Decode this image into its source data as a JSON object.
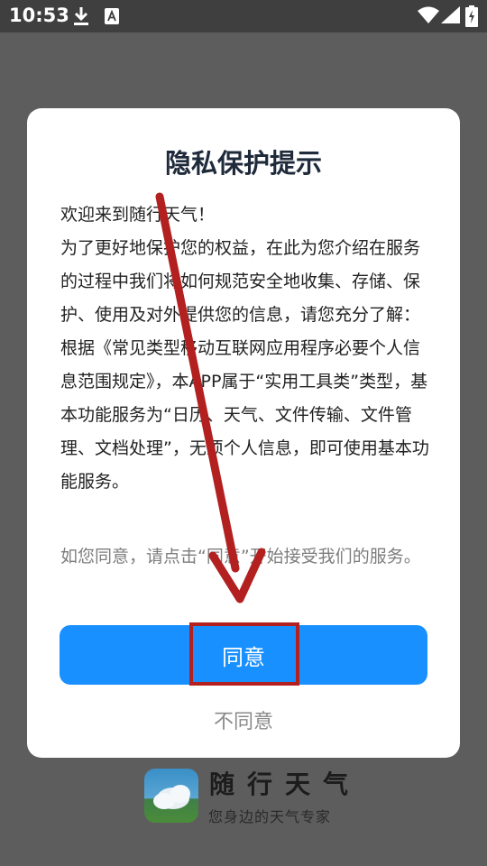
{
  "status_bar": {
    "time": "10:53",
    "icons": [
      "download-icon",
      "a-notification-icon",
      "wifi-icon",
      "signal-icon",
      "battery-charging-icon"
    ]
  },
  "splash": {
    "app_name": "随行天气",
    "tagline": "您身边的天气专家"
  },
  "dialog": {
    "title": "隐私保护提示",
    "paragraphs": [
      "欢迎来到随行天气！",
      "为了更好地保护您的权益，在此为您介绍在服务的过程中我们将如何规范安全地收集、存储、保护、使用及对外提供您的信息，请您充分了解：",
      "根据《常见类型移动互联网应用程序必要个人信息范围规定》，本APP属于“实用工具类”类型，基本功能服务为“日历、天气、文件传输、文件管理、文档处理”，无须个人信息，即可使用基本功能服务。"
    ],
    "hint": "如您同意，请点击“同意”开始接受我们的服务。",
    "agree_label": "同意",
    "disagree_label": "不同意"
  },
  "colors": {
    "primary_button": "#1890ff",
    "annotation_red": "#b32020",
    "overlay_dim": "#5d5d5d"
  }
}
